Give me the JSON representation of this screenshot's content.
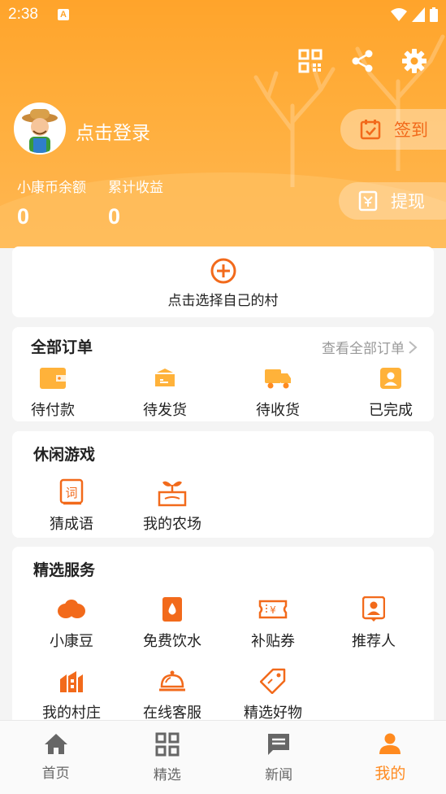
{
  "status_bar": {
    "time": "2:38",
    "badge": "A"
  },
  "header": {
    "login_text": "点击登录",
    "checkin_label": "签到",
    "withdraw_label": "提现",
    "balance_label": "小康币余额",
    "balance_value": "0",
    "earnings_label": "累计收益",
    "earnings_value": "0",
    "actions": [
      "qr-code-icon",
      "share-icon",
      "settings-gear-icon"
    ]
  },
  "village": {
    "label": "点击选择自己的村"
  },
  "orders": {
    "title": "全部订单",
    "view_all": "查看全部订单",
    "items": [
      {
        "label": "待付款",
        "icon": "wallet-icon"
      },
      {
        "label": "待发货",
        "icon": "package-box-icon"
      },
      {
        "label": "待收货",
        "icon": "delivery-truck-icon"
      },
      {
        "label": "已完成",
        "icon": "completed-badge-icon"
      }
    ]
  },
  "games": {
    "title": "休闲游戏",
    "items": [
      {
        "label": "猜成语",
        "icon": "idiom-book-icon"
      },
      {
        "label": "我的农场",
        "icon": "sprout-farm-icon"
      }
    ]
  },
  "services": {
    "title": "精选服务",
    "items": [
      {
        "label": "小康豆",
        "icon": "beans-icon"
      },
      {
        "label": "免费饮水",
        "icon": "water-drop-icon"
      },
      {
        "label": "补贴券",
        "icon": "coupon-icon"
      },
      {
        "label": "推荐人",
        "icon": "referrer-badge-icon"
      },
      {
        "label": "我的村庄",
        "icon": "village-building-icon"
      },
      {
        "label": "在线客服",
        "icon": "service-bell-icon"
      },
      {
        "label": "精选好物",
        "icon": "price-tag-icon"
      }
    ]
  },
  "bottom_nav": {
    "items": [
      {
        "label": "首页",
        "icon": "home-icon"
      },
      {
        "label": "精选",
        "icon": "grid-icon"
      },
      {
        "label": "新闻",
        "icon": "news-chat-icon"
      },
      {
        "label": "我的",
        "icon": "person-icon"
      }
    ],
    "active_index": 3
  },
  "colors": {
    "header_orange": "#ffa42b",
    "accent": "#f26a1b",
    "nav_active": "#ff8a1f"
  }
}
